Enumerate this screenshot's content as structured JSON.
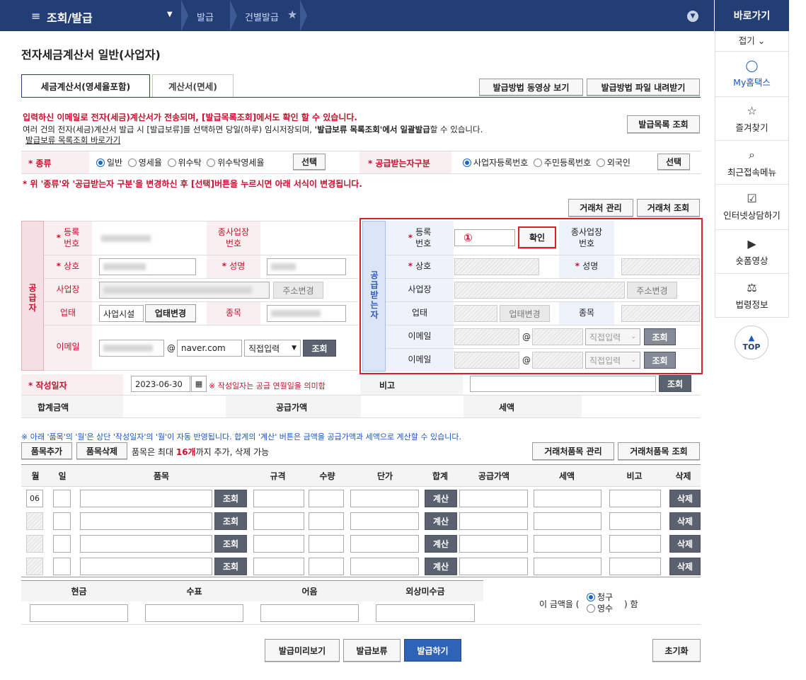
{
  "topnav": {
    "menu": "조회/발급",
    "crumb1": "발급",
    "crumb2": "건별발급"
  },
  "side": {
    "title": "바로가기",
    "fold": "접기",
    "items": [
      "My홈택스",
      "즐겨찾기",
      "최근접속메뉴",
      "인터넷상담하기",
      "숏폼영상",
      "법령정보"
    ],
    "top": "TOP"
  },
  "page": {
    "title": "전자세금계산서 일반(사업자)"
  },
  "tabs": [
    "세금계산서(영세율포함)",
    "계산서(면세)"
  ],
  "buttons": {
    "video": "발급방법 동영상 보기",
    "file": "발급방법 파일 내려받기",
    "list": "발급목록 조회",
    "client_mgmt": "거래처 관리",
    "client_search": "거래처 조회",
    "select": "선택",
    "addr_change": "주소변경",
    "biz_change": "업태변경",
    "search": "조회",
    "confirm": "확인",
    "item_add": "품목추가",
    "item_del": "품목삭제",
    "item_mgmt": "거래처품목 관리",
    "item_search": "거래처품목 조회",
    "calc": "계산",
    "delete": "삭제",
    "preview": "발급미리보기",
    "hold": "발급보류",
    "issue": "발급하기",
    "reset": "초기화"
  },
  "notice": {
    "line1": "입력하신 이메일로 전자(세금)계산서가 전송되며, [발급목록조회]에서도 확인 할 수 있습니다.",
    "line2a": "여러 건의 전자(세금)계산서 발급 시 [발급보류]를 선택하면 당일(하루) 임시저장되며, ",
    "line2b": "'발급보류 목록조회'",
    "line2c": "에서 일괄발급",
    "line2d": "할 수 있습니다.",
    "link": "발급보류 목록조회 바로가기",
    "change": "* 위 '종류'와 '공급받는자 구분'을 변경하신 후 [선택]버튼을 누르시면 아래 서식이 변경됩니다."
  },
  "kind": {
    "label": "종류",
    "options": [
      "일반",
      "영세율",
      "위수탁",
      "위수탁영세율"
    ],
    "selected": "일반"
  },
  "recvtype": {
    "label": "공급받는자구분",
    "options": [
      "사업자등록번호",
      "주민등록번호",
      "외국인"
    ],
    "selected": "사업자등록번호"
  },
  "supplier": {
    "side": "공급자",
    "reg": "등록\n번호",
    "sub": "종사업장\n번호",
    "name": "상호",
    "rep": "성명",
    "addr": "사업장",
    "biz": "업태",
    "biz_value": "사업시설",
    "item": "종목",
    "email": "이메일",
    "domain": "naver.com",
    "domain_select": "직접입력"
  },
  "receiver": {
    "side": "공급받는자",
    "reg": "등록\n번호",
    "marker": "①",
    "sub": "종사업장\n번호",
    "name": "상호",
    "rep": "성명",
    "addr": "사업장",
    "biz": "업태",
    "item": "종목",
    "email": "이메일",
    "domain_select": "직접입력"
  },
  "date": {
    "label": "작성일자",
    "value": "2023-06-30",
    "hint": "※ 작성일자는 공급 연월일을 의미함",
    "memo": "비고"
  },
  "totals": {
    "total": "합계금액",
    "supply": "공급가액",
    "tax": "세액"
  },
  "item_notice": "※ 아래 '품목'의 '월'은 상단 '작성일자'의 '월'이 자동 반영됩니다. 합계의 '계산' 버튼은 금액을 공급가액과 세액으로 계산할 수 있습니다.",
  "item_limit": {
    "pre": "품목은 최대 ",
    "num": "16개",
    "post": "까지 추가, 삭제 가능"
  },
  "item_cols": [
    "월",
    "일",
    "품목",
    "규격",
    "수량",
    "단가",
    "합계",
    "공급가액",
    "세액",
    "비고",
    "삭제"
  ],
  "first_month": "06",
  "pay": {
    "cols": [
      "현금",
      "수표",
      "어음",
      "외상미수금"
    ],
    "text_pre": "이 금액을 (",
    "opt1": "청구",
    "opt2": "영수",
    "text_post": ") 함"
  }
}
